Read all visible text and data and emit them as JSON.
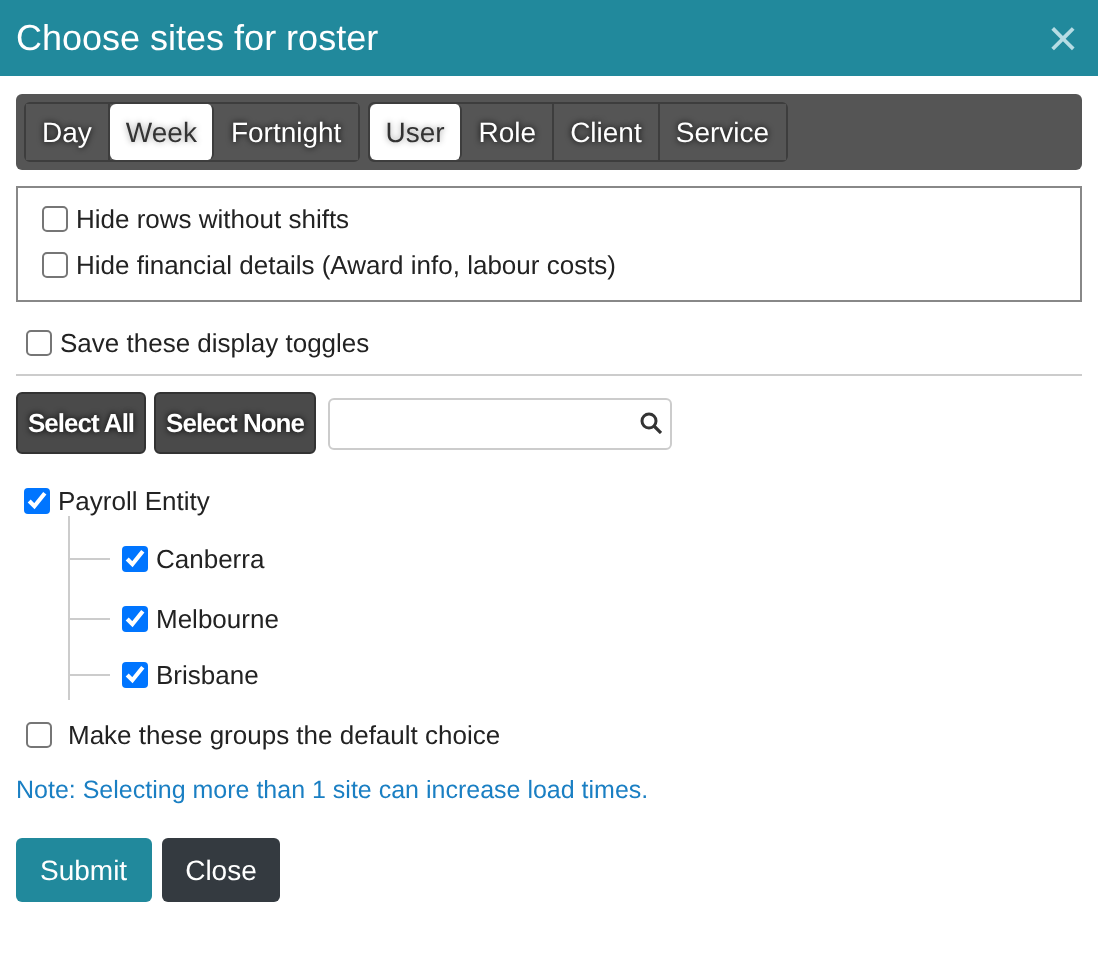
{
  "window": {
    "title": "Choose sites for roster",
    "close": "×"
  },
  "period_tabs": [
    {
      "label": "Day",
      "selected": false
    },
    {
      "label": "Week",
      "selected": true
    },
    {
      "label": "Fortnight",
      "selected": false
    }
  ],
  "group_tabs": [
    {
      "label": "User",
      "selected": true
    },
    {
      "label": "Role",
      "selected": false
    },
    {
      "label": "Client",
      "selected": false
    },
    {
      "label": "Service",
      "selected": false
    }
  ],
  "display_options": [
    {
      "label": "Hide rows without shifts",
      "checked": false
    },
    {
      "label": "Hide financial details (Award info, labour costs)",
      "checked": false
    }
  ],
  "save_toggles": {
    "label": "Save these display toggles",
    "checked": false
  },
  "select_buttons": [
    "Select All",
    "Select None"
  ],
  "tree": {
    "label": "Payroll Entity",
    "checked": true,
    "children": [
      {
        "label": "Canberra",
        "checked": true
      },
      {
        "label": "Melbourne",
        "checked": true
      },
      {
        "label": "Brisbane",
        "checked": true
      }
    ]
  },
  "default_choice": {
    "label": "Make these groups the default choice",
    "checked": false
  },
  "note": "Note: Selecting more than 1 site can increase load times.",
  "buttons": [
    {
      "label": "Submit",
      "kind": "primary"
    },
    {
      "label": "Close",
      "kind": "secondary"
    }
  ]
}
